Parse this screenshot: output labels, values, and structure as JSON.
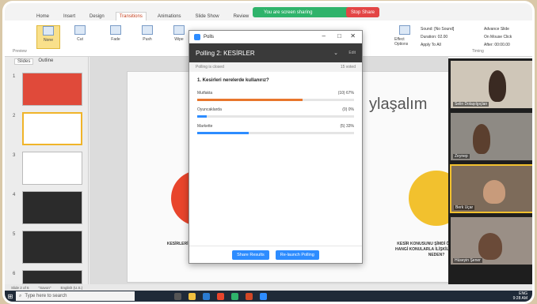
{
  "zoom_banner": {
    "label": "You are screen sharing",
    "stop_label": "Stop Share"
  },
  "ribbon": {
    "tabs": [
      "Home",
      "Insert",
      "Design",
      "Transitions",
      "Animations",
      "Slide Show",
      "Review",
      "View"
    ],
    "buttons": [
      "None",
      "Cut",
      "Fade",
      "Push",
      "Wipe"
    ],
    "group_preview": "Preview",
    "sound_label": "Sound: [No Sound]",
    "duration_label": "Duration: 02.00",
    "apply_all_label": "Apply To All",
    "advance_label": "Advance Slide",
    "on_click_label": "On Mouse Click",
    "after_label": "After: 00:00.00",
    "effect_options": "Effect Options",
    "timing_label": "Timing"
  },
  "slides_panel": {
    "tabs": [
      "Slides",
      "Outline"
    ],
    "numbers": [
      "1",
      "2",
      "3",
      "4",
      "5",
      "6"
    ]
  },
  "slide": {
    "title": "ylaşalım",
    "left_text": "KESİRLERİ NEREDE KULLANDIĞINI...",
    "right_text": "KESİR KONUSUNU ŞİMDİ ÖĞRENDİĞİMİZ HANGİ KONULARLA İLİŞKİLENDİREBİLİRİZ NEDEN?"
  },
  "poll": {
    "window_title": "Polls",
    "header": "Polling 2: KESİRLER",
    "edit": "Edit",
    "status": "Polling is closed",
    "voted": "15 voted",
    "question": "1. Kesirleri nerelerde kullanırız?",
    "options": [
      {
        "label": "Mutfakta",
        "count": "(10) 67%",
        "percent": 67,
        "color": "#e8762c"
      },
      {
        "label": "Oyuncaklarda",
        "count": "(0) 0%",
        "percent": 6,
        "color": "#2d8cff"
      },
      {
        "label": "Markette",
        "count": "(5) 33%",
        "percent": 33,
        "color": "#2d8cff"
      }
    ],
    "share_button": "Share Results",
    "relaunch_button": "Re-launch Polling"
  },
  "videos": [
    {
      "name": "Selin Dolaşılgıçları"
    },
    {
      "name": "Zeynep"
    },
    {
      "name": "Berk Uçar"
    },
    {
      "name": "Hüseyin Şener"
    }
  ],
  "status_bar": {
    "slide_info": "Slide 2 of 6",
    "theme": "\"Savon\"",
    "lang": "English (U.S.)"
  },
  "taskbar": {
    "search_placeholder": "Type here to search",
    "time": "9:28 AM",
    "date": "ENG"
  }
}
